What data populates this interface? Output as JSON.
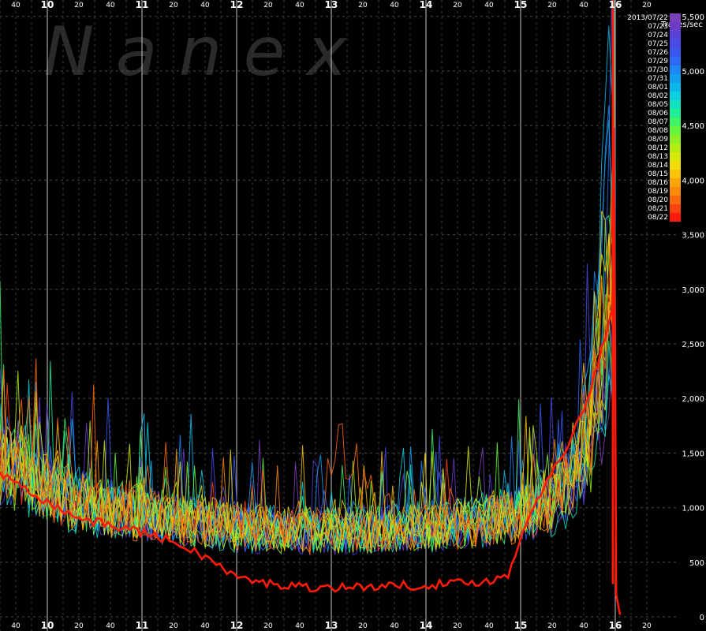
{
  "watermark": "N a n e x",
  "chart_data": {
    "type": "line",
    "ylabel": "Trades/sec",
    "y_ticks": [
      "0",
      "500",
      "1,000",
      "1,500",
      "2,000",
      "2,500",
      "3,000",
      "3,500",
      "4,000",
      "4,500",
      "5,000",
      "5,500"
    ],
    "ylim": [
      0,
      5650
    ],
    "xlim": [
      9.5,
      16.7
    ],
    "x_hour_labels": [
      "10",
      "11",
      "12",
      "13",
      "14",
      "15",
      "16"
    ],
    "x_minute_labels": [
      "40",
      "20",
      "40",
      "20",
      "40",
      "20",
      "40",
      "20",
      "40",
      "20",
      "40",
      "20",
      "40",
      "20",
      "20"
    ],
    "grid": true,
    "legend_position": "right",
    "series": [
      {
        "name": "2013/07/22",
        "color": "#7b3fb8",
        "values": [
          1350,
          1280,
          1150,
          1050,
          980,
          960,
          930,
          900,
          870,
          840,
          820,
          800,
          780,
          770,
          760,
          750,
          740,
          750,
          760,
          770,
          780,
          790,
          800,
          820,
          850,
          900,
          980,
          1100,
          1400,
          2200
        ]
      },
      {
        "name": "07/23",
        "color": "#6a3ec8",
        "values": [
          1400,
          1300,
          1180,
          1080,
          1000,
          970,
          940,
          910,
          880,
          850,
          830,
          810,
          790,
          780,
          770,
          760,
          760,
          760,
          770,
          780,
          790,
          800,
          820,
          840,
          870,
          920,
          1000,
          1150,
          1500,
          2400
        ]
      },
      {
        "name": "07/24",
        "color": "#5a42d8",
        "values": [
          1300,
          1250,
          1120,
          1020,
          960,
          940,
          910,
          880,
          850,
          820,
          800,
          780,
          770,
          760,
          750,
          740,
          740,
          750,
          750,
          760,
          770,
          780,
          800,
          820,
          850,
          900,
          960,
          1100,
          1450,
          2300
        ]
      },
      {
        "name": "07/25",
        "color": "#4a4ae6",
        "values": [
          1450,
          1320,
          1200,
          1100,
          1020,
          980,
          950,
          920,
          890,
          860,
          840,
          820,
          800,
          790,
          780,
          770,
          760,
          770,
          780,
          790,
          800,
          810,
          830,
          850,
          880,
          930,
          1020,
          1200,
          1700,
          3000
        ]
      },
      {
        "name": "07/26",
        "color": "#3a58f0",
        "values": [
          1380,
          1290,
          1160,
          1060,
          990,
          960,
          930,
          900,
          870,
          840,
          820,
          800,
          780,
          770,
          760,
          760,
          750,
          760,
          770,
          780,
          790,
          800,
          820,
          840,
          870,
          920,
          990,
          1150,
          1550,
          2600
        ]
      },
      {
        "name": "07/29",
        "color": "#2e6af6",
        "values": [
          1420,
          1310,
          1190,
          1090,
          1010,
          970,
          940,
          910,
          880,
          850,
          830,
          810,
          790,
          780,
          770,
          760,
          760,
          770,
          780,
          790,
          800,
          810,
          830,
          860,
          890,
          950,
          1040,
          1250,
          1900,
          3600
        ]
      },
      {
        "name": "07/30",
        "color": "#1f86f8",
        "values": [
          1500,
          1350,
          1220,
          1120,
          1040,
          990,
          960,
          930,
          900,
          870,
          850,
          830,
          810,
          800,
          790,
          780,
          780,
          790,
          800,
          810,
          820,
          830,
          850,
          880,
          910,
          980,
          1080,
          1350,
          2100,
          4400
        ]
      },
      {
        "name": "07/31",
        "color": "#12a0f4",
        "values": [
          1480,
          1340,
          1210,
          1110,
          1030,
          985,
          955,
          925,
          895,
          865,
          845,
          825,
          805,
          795,
          785,
          775,
          775,
          785,
          795,
          805,
          815,
          825,
          845,
          870,
          900,
          960,
          1060,
          1300,
          2000,
          4000
        ]
      },
      {
        "name": "08/01",
        "color": "#0ab8ee",
        "values": [
          1550,
          1380,
          1250,
          1140,
          1060,
          1010,
          975,
          945,
          915,
          885,
          860,
          840,
          820,
          810,
          800,
          790,
          790,
          800,
          810,
          820,
          830,
          840,
          860,
          890,
          930,
          1000,
          1110,
          1400,
          2300,
          5200
        ]
      },
      {
        "name": "08/02",
        "color": "#08d0e0",
        "values": [
          1360,
          1270,
          1140,
          1040,
          975,
          950,
          920,
          890,
          860,
          830,
          810,
          790,
          770,
          760,
          750,
          750,
          740,
          750,
          760,
          770,
          780,
          790,
          810,
          830,
          860,
          910,
          980,
          1130,
          1500,
          2500
        ]
      },
      {
        "name": "08/05",
        "color": "#10e2c0",
        "values": [
          1320,
          1240,
          1110,
          1010,
          950,
          930,
          900,
          870,
          840,
          810,
          790,
          770,
          755,
          745,
          735,
          730,
          730,
          740,
          745,
          755,
          765,
          775,
          795,
          815,
          845,
          890,
          950,
          1080,
          1400,
          2200
        ]
      },
      {
        "name": "08/06",
        "color": "#22ee98",
        "values": [
          1430,
          1320,
          1200,
          1100,
          1020,
          975,
          945,
          915,
          885,
          855,
          835,
          815,
          795,
          785,
          775,
          765,
          765,
          775,
          785,
          795,
          805,
          815,
          835,
          860,
          890,
          950,
          1040,
          1250,
          1800,
          3200
        ]
      },
      {
        "name": "08/07",
        "color": "#40f468",
        "values": [
          1460,
          1330,
          1205,
          1105,
          1025,
          980,
          950,
          920,
          890,
          860,
          840,
          820,
          800,
          790,
          780,
          770,
          770,
          780,
          790,
          800,
          810,
          820,
          840,
          865,
          895,
          955,
          1050,
          1280,
          1850,
          3300
        ]
      },
      {
        "name": "08/08",
        "color": "#66f43c",
        "values": [
          1400,
          1300,
          1175,
          1075,
          1000,
          965,
          935,
          905,
          875,
          845,
          825,
          805,
          785,
          775,
          765,
          755,
          755,
          765,
          775,
          785,
          795,
          805,
          825,
          850,
          880,
          935,
          1020,
          1200,
          1650,
          2800
        ]
      },
      {
        "name": "08/09",
        "color": "#8ef020",
        "values": [
          1340,
          1260,
          1130,
          1030,
          965,
          940,
          910,
          880,
          850,
          820,
          800,
          780,
          765,
          755,
          745,
          740,
          740,
          750,
          755,
          765,
          775,
          785,
          805,
          825,
          855,
          900,
          970,
          1110,
          1450,
          2400
        ]
      },
      {
        "name": "08/12",
        "color": "#b4ec10",
        "values": [
          1390,
          1290,
          1165,
          1065,
          995,
          960,
          930,
          900,
          870,
          840,
          820,
          800,
          780,
          770,
          760,
          755,
          755,
          765,
          770,
          780,
          790,
          800,
          820,
          845,
          875,
          930,
          1010,
          1180,
          1600,
          2700
        ]
      },
      {
        "name": "08/13",
        "color": "#d8e808",
        "values": [
          1440,
          1320,
          1195,
          1095,
          1015,
          975,
          945,
          915,
          885,
          855,
          835,
          815,
          795,
          785,
          775,
          765,
          765,
          775,
          785,
          795,
          805,
          815,
          835,
          860,
          890,
          950,
          1040,
          1240,
          1750,
          3000
        ]
      },
      {
        "name": "08/14",
        "color": "#f2dc04",
        "values": [
          1470,
          1335,
          1210,
          1110,
          1030,
          985,
          955,
          925,
          895,
          865,
          845,
          825,
          805,
          795,
          785,
          775,
          775,
          785,
          795,
          805,
          815,
          825,
          845,
          870,
          900,
          960,
          1060,
          1290,
          1900,
          3400
        ]
      },
      {
        "name": "08/15",
        "color": "#fcc204",
        "values": [
          1520,
          1360,
          1235,
          1130,
          1050,
          1000,
          965,
          935,
          905,
          875,
          855,
          835,
          815,
          805,
          795,
          785,
          785,
          795,
          805,
          815,
          825,
          835,
          855,
          880,
          915,
          980,
          1090,
          1350,
          2050,
          3700
        ]
      },
      {
        "name": "08/16",
        "color": "#fea606",
        "values": [
          1410,
          1305,
          1180,
          1080,
          1005,
          968,
          938,
          908,
          878,
          848,
          828,
          808,
          788,
          778,
          768,
          760,
          760,
          770,
          780,
          790,
          800,
          810,
          830,
          855,
          885,
          940,
          1025,
          1210,
          1700,
          2900
        ]
      },
      {
        "name": "08/19",
        "color": "#fe8a08",
        "values": [
          1370,
          1280,
          1150,
          1050,
          985,
          955,
          925,
          895,
          865,
          835,
          815,
          795,
          775,
          765,
          755,
          750,
          750,
          760,
          765,
          775,
          785,
          795,
          815,
          840,
          870,
          920,
          1000,
          1160,
          1550,
          2600
        ]
      },
      {
        "name": "08/20",
        "color": "#fe6a0a",
        "values": [
          1420,
          1315,
          1190,
          1090,
          1012,
          972,
          942,
          912,
          882,
          852,
          832,
          812,
          792,
          782,
          772,
          765,
          1500,
          1200,
          900,
          820,
          815,
          820,
          840,
          865,
          895,
          955,
          1045,
          1260,
          1800,
          3100
        ]
      },
      {
        "name": "08/21",
        "color": "#fe440c",
        "values": [
          1390,
          1295,
          1170,
          1070,
          998,
          962,
          932,
          902,
          872,
          842,
          822,
          802,
          782,
          772,
          762,
          756,
          756,
          766,
          776,
          786,
          796,
          806,
          826,
          850,
          880,
          935,
          1020,
          1200,
          1650,
          2800
        ]
      },
      {
        "name": "08/22",
        "color": "#ff1a0a",
        "values": [
          1300,
          1220,
          1080,
          970,
          890,
          850,
          810,
          760,
          700,
          620,
          520,
          380,
          320,
          300,
          280,
          270,
          270,
          275,
          280,
          285,
          290,
          300,
          310,
          330,
          360,
          900,
          1300,
          1600,
          2100,
          2800
        ]
      }
    ]
  }
}
